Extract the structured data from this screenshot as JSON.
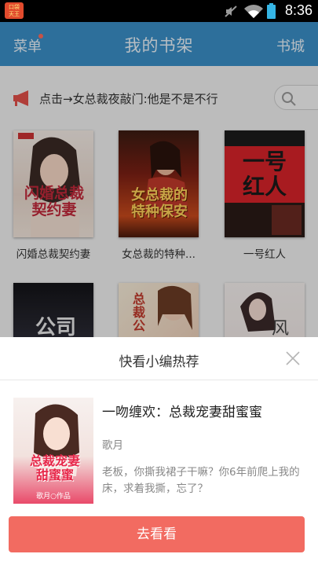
{
  "status_bar": {
    "app_badge": [
      "口袋",
      "天王"
    ],
    "time": "8:36"
  },
  "top_bar": {
    "menu_label": "菜单",
    "title": "我的书架",
    "store_label": "书城"
  },
  "notice": {
    "text": "点击→女总裁夜敲门:他是不是不行"
  },
  "shelf": {
    "books": [
      {
        "label": "闪婚总裁契约妻",
        "cover_text": [
          "闪婚总裁",
          "契约妻"
        ]
      },
      {
        "label": "女总裁的特种...",
        "cover_text": [
          "女总裁的",
          "特种保安"
        ]
      },
      {
        "label": "一号红人",
        "cover_text": [
          "一号",
          "红人"
        ]
      },
      {
        "label": "",
        "cover_text": [
          "公司"
        ]
      },
      {
        "label": "",
        "cover_text": [
          "总",
          "裁",
          "公"
        ]
      },
      {
        "label": "",
        "cover_text": [
          "风"
        ]
      }
    ]
  },
  "recommend": {
    "header": "快看小编热荐",
    "title": "一吻缠欢：总裁宠妻甜蜜蜜",
    "author": "歌月",
    "description": "老板，你撕我裙子干嘛？你6年前爬上我的床，求着我撕，忘了？",
    "cover_text": [
      "总裁宠妻",
      "甜蜜蜜",
      "歌月○作品"
    ],
    "action_label": "去看看"
  },
  "colors": {
    "accent": "#3a8fc7",
    "button": "#f26b61",
    "notice_icon": "#e2504a"
  }
}
